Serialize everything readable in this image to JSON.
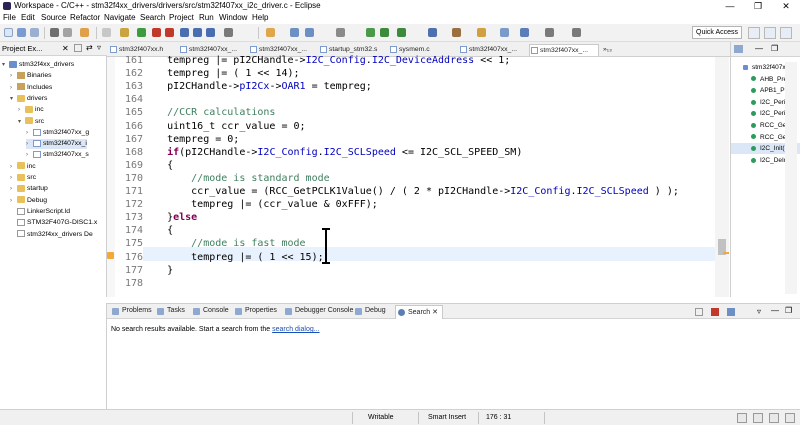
{
  "window": {
    "title": "Workspace - C/C++ - stm32f4xx_drivers/drivers/src/stm32f407xx_i2c_driver.c - Eclipse",
    "minimize": "—",
    "maximize": "❐",
    "close": "✕"
  },
  "menu": [
    "File",
    "Edit",
    "Source",
    "Refactor",
    "Navigate",
    "Search",
    "Project",
    "Run",
    "Window",
    "Help"
  ],
  "toolbar": {
    "quick_access_placeholder": "Quick Access"
  },
  "project_explorer": {
    "tab_label": "Project Ex...",
    "tree": [
      {
        "label": "stm32f4xx_drivers",
        "arrow": "▾",
        "icon": "proj",
        "level": 0
      },
      {
        "label": "Binaries",
        "arrow": "›",
        "icon": "lib",
        "level": 1
      },
      {
        "label": "Includes",
        "arrow": "›",
        "icon": "lib",
        "level": 1
      },
      {
        "label": "drivers",
        "arrow": "▾",
        "icon": "folder",
        "level": 1
      },
      {
        "label": "inc",
        "arrow": "›",
        "icon": "folder",
        "level": 2
      },
      {
        "label": "src",
        "arrow": "▾",
        "icon": "folder",
        "level": 2
      },
      {
        "label": "stm32f407xx_g",
        "arrow": "›",
        "icon": "cfile",
        "level": 3
      },
      {
        "label": "stm32f407xx_i",
        "arrow": "›",
        "icon": "cfile",
        "level": 3,
        "selected": true
      },
      {
        "label": "stm32f407xx_s",
        "arrow": "›",
        "icon": "cfile",
        "level": 3
      },
      {
        "label": "inc",
        "arrow": "›",
        "icon": "folder",
        "level": 1
      },
      {
        "label": "src",
        "arrow": "›",
        "icon": "folder",
        "level": 1
      },
      {
        "label": "startup",
        "arrow": "›",
        "icon": "folder",
        "level": 1
      },
      {
        "label": "Debug",
        "arrow": "›",
        "icon": "folder",
        "level": 1
      },
      {
        "label": "LinkerScript.ld",
        "arrow": "",
        "icon": "ld",
        "level": 1
      },
      {
        "label": "STM32F407G-DISC1.x",
        "arrow": "",
        "icon": "ld",
        "level": 1
      },
      {
        "label": "stm32f4xx_drivers De",
        "arrow": "",
        "icon": "ld",
        "level": 1
      }
    ]
  },
  "editor_tabs": [
    {
      "label": "stm32f407xx.h"
    },
    {
      "label": "stm32f407xx_..."
    },
    {
      "label": "stm32f407xx_..."
    },
    {
      "label": "startup_stm32.s"
    },
    {
      "label": "sysmem.c"
    },
    {
      "label": "stm32f407xx_..."
    },
    {
      "label": "stm32f407xx_...",
      "active": true
    },
    {
      "label": "»₁₃"
    }
  ],
  "code": {
    "current_line": 176,
    "lines": [
      {
        "n": "161",
        "parts": [
          [
            "",
            "    tempreg |= pI2CHandle->"
          ],
          [
            "fld",
            "I2C_Config"
          ],
          [
            "",
            "."
          ],
          [
            "fld",
            "I2C_DeviceAddress"
          ],
          [
            "",
            " << 1;"
          ]
        ]
      },
      {
        "n": "162",
        "parts": [
          [
            "",
            "    tempreg |= ( 1 << 14);"
          ]
        ]
      },
      {
        "n": "163",
        "parts": [
          [
            "",
            "    pI2CHandle->"
          ],
          [
            "fld",
            "pI2Cx"
          ],
          [
            "",
            "->"
          ],
          [
            "fld",
            "OAR1"
          ],
          [
            "",
            " = tempreg;"
          ]
        ]
      },
      {
        "n": "164",
        "parts": [
          [
            "",
            ""
          ]
        ]
      },
      {
        "n": "165",
        "parts": [
          [
            "cm",
            "    //CCR calculations"
          ]
        ]
      },
      {
        "n": "166",
        "parts": [
          [
            "",
            "    uint16_t ccr_value = 0;"
          ]
        ]
      },
      {
        "n": "167",
        "parts": [
          [
            "",
            "    tempreg = 0;"
          ]
        ]
      },
      {
        "n": "168",
        "parts": [
          [
            "kw",
            "    if"
          ],
          [
            "",
            "(pI2CHandle->"
          ],
          [
            "fld",
            "I2C_Config"
          ],
          [
            "",
            "."
          ],
          [
            "fld",
            "I2C_SCLSpeed"
          ],
          [
            "",
            " <= I2C_SCL_SPEED_SM)"
          ]
        ]
      },
      {
        "n": "169",
        "parts": [
          [
            "",
            "    {"
          ]
        ]
      },
      {
        "n": "170",
        "parts": [
          [
            "cm",
            "        //mode is standard mode"
          ]
        ]
      },
      {
        "n": "171",
        "parts": [
          [
            "",
            "        ccr_value = (RCC_GetPCLK1Value() / ( 2 * pI2CHandle->"
          ],
          [
            "fld",
            "I2C_Config"
          ],
          [
            "",
            "."
          ],
          [
            "fld",
            "I2C_SCLSpeed"
          ],
          [
            "",
            " ) );"
          ]
        ]
      },
      {
        "n": "172",
        "parts": [
          [
            "",
            "        tempreg |= (ccr_value & 0xFFF);"
          ]
        ]
      },
      {
        "n": "173",
        "parts": [
          [
            "",
            "    }"
          ],
          [
            "kw",
            "else"
          ]
        ]
      },
      {
        "n": "174",
        "parts": [
          [
            "",
            "    {"
          ]
        ]
      },
      {
        "n": "175",
        "parts": [
          [
            "cm",
            "        //mode is fast mode"
          ]
        ]
      },
      {
        "n": "176",
        "parts": [
          [
            "",
            "        tempreg |= ( 1 << 15);"
          ]
        ]
      },
      {
        "n": "177",
        "parts": [
          [
            "",
            "    }"
          ]
        ]
      },
      {
        "n": "178",
        "parts": [
          [
            "",
            ""
          ]
        ]
      }
    ]
  },
  "outline": {
    "items": [
      {
        "label": "stm32f407x",
        "dot": false
      },
      {
        "label": "AHB_PreSc",
        "dot": true
      },
      {
        "label": "APB1_PreS",
        "dot": true
      },
      {
        "label": "I2C_Periph",
        "dot": true
      },
      {
        "label": "I2C_PeriClo",
        "dot": true
      },
      {
        "label": "RCC_GetPL",
        "dot": true
      },
      {
        "label": "RCC_GetPC",
        "dot": true
      },
      {
        "label": "I2C_Init(I2",
        "dot": true,
        "selected": true
      },
      {
        "label": "I2C_DeInit(",
        "dot": true
      }
    ]
  },
  "bottom_tabs": [
    {
      "label": "Problems"
    },
    {
      "label": "Tasks"
    },
    {
      "label": "Console"
    },
    {
      "label": "Properties"
    },
    {
      "label": "Debugger Console"
    },
    {
      "label": "Debug"
    },
    {
      "label": "Search",
      "active": true
    }
  ],
  "search": {
    "message": "No search results available. Start a search from the",
    "link": "search dialog...",
    "suffix": ""
  },
  "status": {
    "writable": "Writable",
    "insert_mode": "Smart Insert",
    "position": "176 : 31"
  }
}
